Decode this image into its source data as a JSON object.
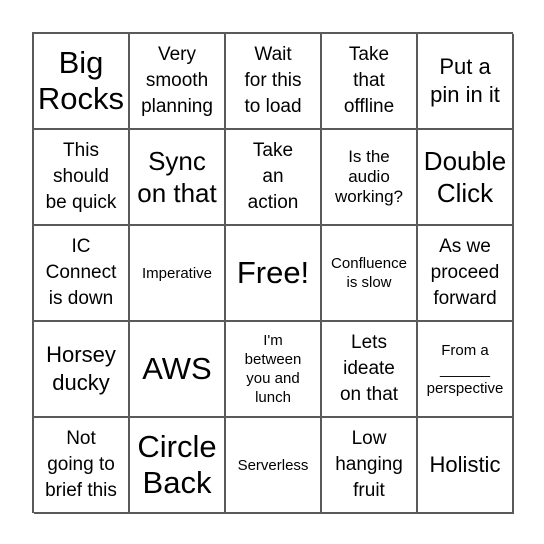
{
  "board": {
    "cells": [
      {
        "text": "Big\nRocks",
        "size": "s-xl"
      },
      {
        "text": "Very\nsmooth\nplanning",
        "size": "s-s"
      },
      {
        "text": "Wait\nfor this\nto load",
        "size": "s-s"
      },
      {
        "text": "Take\nthat\noffline",
        "size": "s-s"
      },
      {
        "text": "Put a\npin in it",
        "size": "s-m"
      },
      {
        "text": "This\nshould\nbe quick",
        "size": "s-s"
      },
      {
        "text": "Sync\non that",
        "size": "s-l"
      },
      {
        "text": "Take\nan\naction",
        "size": "s-s"
      },
      {
        "text": "Is the\naudio\nworking?",
        "size": "s-xs"
      },
      {
        "text": "Double\nClick",
        "size": "s-l"
      },
      {
        "text": "IC\nConnect\nis down",
        "size": "s-s"
      },
      {
        "text": "Imperative",
        "size": "s-xxs"
      },
      {
        "text": "Free!",
        "size": "free"
      },
      {
        "text": "Confluence\nis slow",
        "size": "s-xxxs"
      },
      {
        "text": "As we\nproceed\nforward",
        "size": "s-s"
      },
      {
        "text": "Horsey\nducky",
        "size": "s-m"
      },
      {
        "text": "AWS",
        "size": "s-xl"
      },
      {
        "text": "I'm\nbetween\nyou and\nlunch",
        "size": "s-xxs"
      },
      {
        "text": "Lets\nideate\non that",
        "size": "s-s"
      },
      {
        "text": "From a\n______\nperspective",
        "size": "s-xxs",
        "blank": true
      },
      {
        "text": "Not\ngoing to\nbrief this",
        "size": "s-s"
      },
      {
        "text": "Circle\nBack",
        "size": "s-xl"
      },
      {
        "text": "Serverless",
        "size": "s-xxs"
      },
      {
        "text": "Low\nhanging\nfruit",
        "size": "s-s"
      },
      {
        "text": "Holistic",
        "size": "s-m"
      }
    ]
  }
}
